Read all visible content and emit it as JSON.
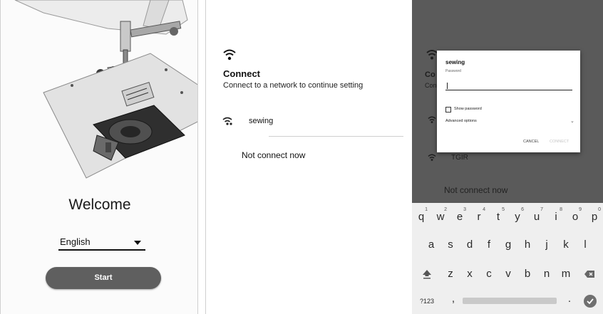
{
  "welcome_screen": {
    "title": "Welcome",
    "language": "English",
    "start_label": "Start"
  },
  "connect_screen": {
    "title": "Connect",
    "subtitle": "Connect to a network to continue setting",
    "networks": [
      "sewing"
    ],
    "not_connect_label": "Not connect now"
  },
  "password_dialog": {
    "network_name": "sewing",
    "password_label": "Password",
    "password_value": "",
    "show_password_label": "Show password",
    "advanced_options_label": "Advanced options",
    "cancel_label": "CANCEL",
    "connect_label": "CONNECT",
    "background_title_fragment": "Co",
    "background_subtitle_fragment": "Con",
    "background_network_fragment": "TGIR",
    "background_not_connect": "Not connect now"
  },
  "keyboard": {
    "row1": [
      "q",
      "w",
      "e",
      "r",
      "t",
      "y",
      "u",
      "i",
      "o",
      "p"
    ],
    "row1_hints": [
      "1",
      "2",
      "3",
      "4",
      "5",
      "6",
      "7",
      "8",
      "9",
      "0"
    ],
    "row2": [
      "a",
      "s",
      "d",
      "f",
      "g",
      "h",
      "j",
      "k",
      "l"
    ],
    "row3": [
      "z",
      "x",
      "c",
      "v",
      "b",
      "n",
      "m"
    ],
    "symbols_label": "?123",
    "comma": ",",
    "period": "."
  }
}
